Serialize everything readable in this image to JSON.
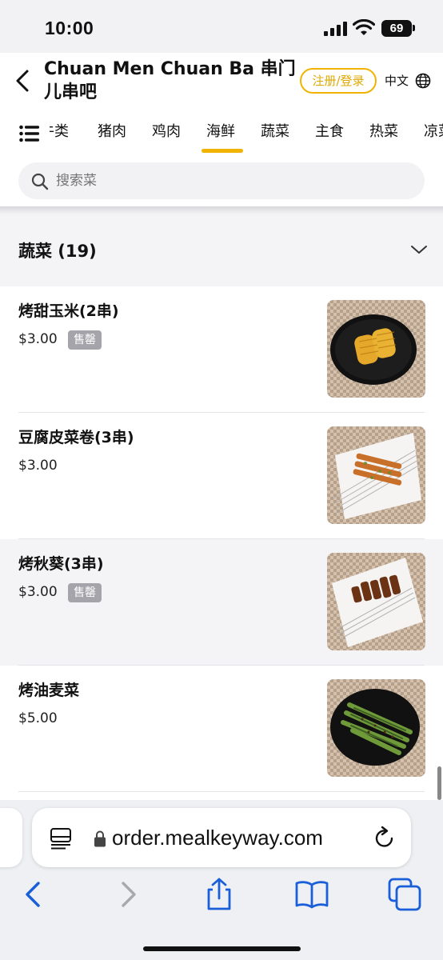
{
  "status_bar": {
    "time": "10:00",
    "battery": "69"
  },
  "header": {
    "title": "Chuan Men Chuan Ba 串门儿串吧",
    "login_label": "注册/登录",
    "language": "中文"
  },
  "tabs": [
    {
      "label": "牛类"
    },
    {
      "label": "猪肉"
    },
    {
      "label": "鸡肉"
    },
    {
      "label": "海鲜",
      "active": true
    },
    {
      "label": "蔬菜"
    },
    {
      "label": "主食"
    },
    {
      "label": "热菜"
    },
    {
      "label": "凉菜"
    }
  ],
  "search": {
    "placeholder": "搜索菜"
  },
  "category": {
    "title": "蔬菜 (19)"
  },
  "items": [
    {
      "name": "烤甜玉米(2串)",
      "price": "$3.00",
      "badge": "售罄",
      "image": "corn-on-black-plate"
    },
    {
      "name": "豆腐皮菜卷(3串)",
      "price": "$3.00",
      "badge": "",
      "image": "tofu-skin-rolls-on-white-plate"
    },
    {
      "name": "烤秋葵(3串)",
      "price": "$3.00",
      "badge": "售罄",
      "image": "okra-skewers-on-white-plate"
    },
    {
      "name": "烤油麦菜",
      "price": "$5.00",
      "badge": "",
      "image": "lettuce-on-black-plate"
    }
  ],
  "browser": {
    "url": "order.mealkeyway.com"
  },
  "colors": {
    "accent": "#f0b400",
    "ios_blue": "#1a5fd9",
    "badge_gray": "#a4a4aa"
  }
}
